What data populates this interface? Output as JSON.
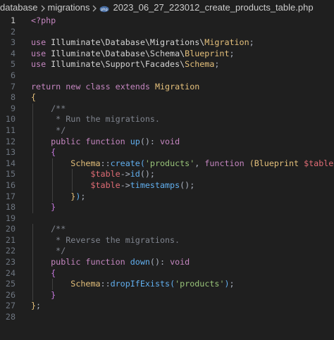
{
  "breadcrumb": {
    "items": [
      "database",
      "migrations",
      "2023_06_27_223012_create_products_table.php"
    ],
    "file_icon": "php-file-icon"
  },
  "editor": {
    "active_line": 1,
    "lines": [
      {
        "n": "1",
        "tokens": [
          {
            "t": "<?php",
            "c": "t-tag"
          }
        ]
      },
      {
        "n": "2",
        "tokens": []
      },
      {
        "n": "3",
        "tokens": [
          {
            "t": "use ",
            "c": "t-kw"
          },
          {
            "t": "Illuminate\\Database\\Migrations\\",
            "c": "t-ns"
          },
          {
            "t": "Migration",
            "c": "t-cls"
          },
          {
            "t": ";",
            "c": "t-punc"
          }
        ]
      },
      {
        "n": "4",
        "tokens": [
          {
            "t": "use ",
            "c": "t-kw"
          },
          {
            "t": "Illuminate\\Database\\Schema\\",
            "c": "t-ns"
          },
          {
            "t": "Blueprint",
            "c": "t-cls"
          },
          {
            "t": ";",
            "c": "t-punc"
          }
        ]
      },
      {
        "n": "5",
        "tokens": [
          {
            "t": "use ",
            "c": "t-kw"
          },
          {
            "t": "Illuminate\\Support\\Facades\\",
            "c": "t-ns"
          },
          {
            "t": "Schema",
            "c": "t-cls"
          },
          {
            "t": ";",
            "c": "t-punc"
          }
        ]
      },
      {
        "n": "6",
        "tokens": []
      },
      {
        "n": "7",
        "tokens": [
          {
            "t": "return ",
            "c": "t-kw"
          },
          {
            "t": "new ",
            "c": "t-kw"
          },
          {
            "t": "class ",
            "c": "t-kw"
          },
          {
            "t": "extends ",
            "c": "t-kw"
          },
          {
            "t": "Migration",
            "c": "t-cls"
          }
        ]
      },
      {
        "n": "8",
        "tokens": [
          {
            "t": "{",
            "c": "t-brace1"
          }
        ]
      },
      {
        "n": "9",
        "tokens": [
          {
            "t": "    /**",
            "c": "t-com"
          }
        ]
      },
      {
        "n": "10",
        "tokens": [
          {
            "t": "     * Run the migrations.",
            "c": "t-com"
          }
        ]
      },
      {
        "n": "11",
        "tokens": [
          {
            "t": "     */",
            "c": "t-com"
          }
        ]
      },
      {
        "n": "12",
        "tokens": [
          {
            "t": "    public ",
            "c": "t-kw"
          },
          {
            "t": "function ",
            "c": "t-kw"
          },
          {
            "t": "up",
            "c": "t-fn"
          },
          {
            "t": "(): ",
            "c": "t-punc"
          },
          {
            "t": "void",
            "c": "t-kw"
          }
        ]
      },
      {
        "n": "13",
        "tokens": [
          {
            "t": "    ",
            "c": "t-punc"
          },
          {
            "t": "{",
            "c": "t-brace2"
          }
        ]
      },
      {
        "n": "14",
        "tokens": [
          {
            "t": "        ",
            "c": "t-punc"
          },
          {
            "t": "Schema",
            "c": "t-cls"
          },
          {
            "t": "::",
            "c": "t-punc"
          },
          {
            "t": "create",
            "c": "t-fn"
          },
          {
            "t": "(",
            "c": "t-brace3"
          },
          {
            "t": "'products'",
            "c": "t-str"
          },
          {
            "t": ", ",
            "c": "t-punc"
          },
          {
            "t": "function ",
            "c": "t-kw"
          },
          {
            "t": "(",
            "c": "t-brace1"
          },
          {
            "t": "Blueprint ",
            "c": "t-cls"
          },
          {
            "t": "$table",
            "c": "t-var"
          },
          {
            "t": ") ",
            "c": "t-brace1"
          },
          {
            "t": "{",
            "c": "t-brace1"
          }
        ]
      },
      {
        "n": "15",
        "tokens": [
          {
            "t": "            ",
            "c": "t-punc"
          },
          {
            "t": "$table",
            "c": "t-var"
          },
          {
            "t": "->",
            "c": "t-punc"
          },
          {
            "t": "id",
            "c": "t-fn"
          },
          {
            "t": "();",
            "c": "t-punc"
          }
        ]
      },
      {
        "n": "16",
        "tokens": [
          {
            "t": "            ",
            "c": "t-punc"
          },
          {
            "t": "$table",
            "c": "t-var"
          },
          {
            "t": "->",
            "c": "t-punc"
          },
          {
            "t": "timestamps",
            "c": "t-fn"
          },
          {
            "t": "();",
            "c": "t-punc"
          }
        ]
      },
      {
        "n": "17",
        "tokens": [
          {
            "t": "        ",
            "c": "t-punc"
          },
          {
            "t": "}",
            "c": "t-brace1"
          },
          {
            "t": ")",
            "c": "t-brace3"
          },
          {
            "t": ";",
            "c": "t-punc"
          }
        ]
      },
      {
        "n": "18",
        "tokens": [
          {
            "t": "    ",
            "c": "t-punc"
          },
          {
            "t": "}",
            "c": "t-brace2"
          }
        ]
      },
      {
        "n": "19",
        "tokens": []
      },
      {
        "n": "20",
        "tokens": [
          {
            "t": "    /**",
            "c": "t-com"
          }
        ]
      },
      {
        "n": "21",
        "tokens": [
          {
            "t": "     * Reverse the migrations.",
            "c": "t-com"
          }
        ]
      },
      {
        "n": "22",
        "tokens": [
          {
            "t": "     */",
            "c": "t-com"
          }
        ]
      },
      {
        "n": "23",
        "tokens": [
          {
            "t": "    public ",
            "c": "t-kw"
          },
          {
            "t": "function ",
            "c": "t-kw"
          },
          {
            "t": "down",
            "c": "t-fn"
          },
          {
            "t": "(): ",
            "c": "t-punc"
          },
          {
            "t": "void",
            "c": "t-kw"
          }
        ]
      },
      {
        "n": "24",
        "tokens": [
          {
            "t": "    ",
            "c": "t-punc"
          },
          {
            "t": "{",
            "c": "t-brace2"
          }
        ]
      },
      {
        "n": "25",
        "tokens": [
          {
            "t": "        ",
            "c": "t-punc"
          },
          {
            "t": "Schema",
            "c": "t-cls"
          },
          {
            "t": "::",
            "c": "t-punc"
          },
          {
            "t": "dropIfExists",
            "c": "t-fn"
          },
          {
            "t": "(",
            "c": "t-brace3"
          },
          {
            "t": "'products'",
            "c": "t-str"
          },
          {
            "t": ")",
            "c": "t-brace3"
          },
          {
            "t": ";",
            "c": "t-punc"
          }
        ]
      },
      {
        "n": "26",
        "tokens": [
          {
            "t": "    ",
            "c": "t-punc"
          },
          {
            "t": "}",
            "c": "t-brace2"
          }
        ]
      },
      {
        "n": "27",
        "tokens": [
          {
            "t": "}",
            "c": "t-brace1"
          },
          {
            "t": ";",
            "c": "t-punc"
          }
        ]
      },
      {
        "n": "28",
        "tokens": []
      }
    ]
  }
}
